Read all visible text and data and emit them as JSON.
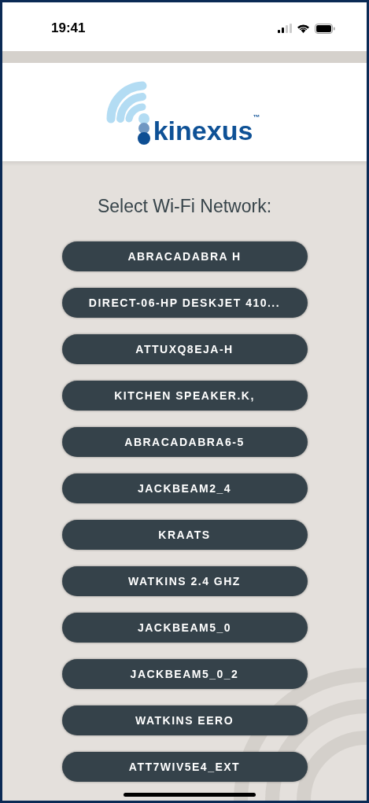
{
  "status_bar": {
    "time": "19:41"
  },
  "logo": {
    "text": "kinexus",
    "trademark": "™"
  },
  "title": "Select Wi-Fi Network:",
  "networks": [
    {
      "name": "ABRACADABRA H"
    },
    {
      "name": "DIRECT-06-HP DESKJET 410..."
    },
    {
      "name": "ATTUXQ8EJA-H"
    },
    {
      "name": "KITCHEN SPEAKER.K,"
    },
    {
      "name": "ABRACADABRA6-5"
    },
    {
      "name": "JACKBEAM2_4"
    },
    {
      "name": "KRAATS"
    },
    {
      "name": "WATKINS 2.4 GHZ"
    },
    {
      "name": "JACKBEAM5_0"
    },
    {
      "name": "JACKBEAM5_0_2"
    },
    {
      "name": "WATKINS EERO"
    },
    {
      "name": "ATT7WIV5E4_EXT"
    }
  ]
}
